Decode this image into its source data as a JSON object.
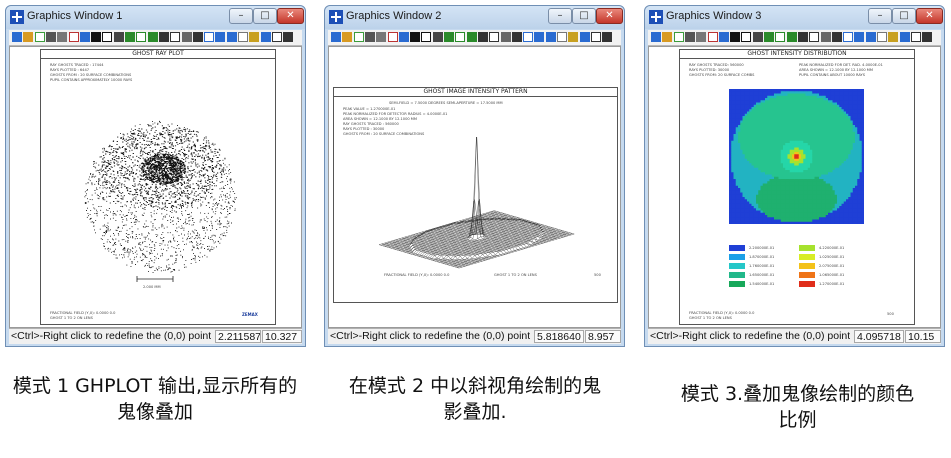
{
  "windows": [
    {
      "title": "Graphics Window 1",
      "plot_title": "GHOST RAY PLOT",
      "info_lines": [
        "RAY GHOSTS TRACED : 17444",
        "RAYS PLOTTED : 6447",
        "GHOSTS FROM : 20 SURFACE COMBINATIONS",
        "PUPIL CONTAINS APPROXIMATELY 10000 RAYS"
      ],
      "scale_label": "2.000 MM",
      "footer_lines": [
        "FRACTIONAL FIELD (Y,X): 0.0000 0.0",
        "GHOST 1 TO 2 ON LENS"
      ],
      "footer_right": "ZEMAX",
      "status": {
        "message": "<Ctrl>-Right click to redefine the (0,0) point",
        "x": "2.211587",
        "y": "10.327"
      },
      "caption": "模式 1 GHPLOT 输出,显示所有的鬼像叠加"
    },
    {
      "title": "Graphics Window 2",
      "plot_title": "GHOST IMAGE INTENSITY PATTERN",
      "info_lines": [
        "SEMI-FIELD = 7.5000 DEGREES  SEMI-APERTURE = 17.5000 MM",
        "PEAK VALUE = 1.270000E-01",
        "PEAK NORMALIZED FOR DETECTOR RADIUS = 4.0000E-01",
        "AREA SHOWN = 12.1000 BY 12.1000 MM",
        "RAY GHOSTS TRACED : 560000",
        "RAYS PLOTTED : 30000",
        "GHOSTS FROM : 20 SURFACE COMBINATIONS"
      ],
      "footer_lines": [
        "FRACTIONAL FIELD (Y,X): 0.0000 0.0",
        "GHOST 1 TO 2 ON LENS"
      ],
      "footer_right": "500",
      "status": {
        "message": "<Ctrl>-Right click to redefine the (0,0) point",
        "x": "5.818640",
        "y": "8.957"
      },
      "caption": "在模式 2 中以斜视角绘制的鬼影叠加."
    },
    {
      "title": "Graphics Window 3",
      "plot_title": "GHOST INTENSITY DISTRIBUTION",
      "info_lines": [
        "RAY GHOSTS TRACED: 560000",
        "RAYS PLOTTED: 30000",
        "GHOSTS FROM: 20 SURFACE COMBS",
        "PEAK NORMALIZED FOR DET. RAD. 4.0000E-01",
        "AREA SHOWN = 12.1000 BY 12.1000 MM",
        "PUPIL CONTAINS ABOUT 10000 RAYS"
      ],
      "legend": [
        {
          "value": "2.200000E-01",
          "color": "#1f3fd6"
        },
        {
          "value": "1.870000E-01",
          "color": "#1ba0e8"
        },
        {
          "value": "1.760000E-01",
          "color": "#25c7c8"
        },
        {
          "value": "1.650000E-01",
          "color": "#21b88a"
        },
        {
          "value": "1.540000E-01",
          "color": "#17a85a"
        },
        {
          "value": "4.220000E-01",
          "color": "#a6e22e"
        },
        {
          "value": "1.025000E-01",
          "color": "#d8ed25"
        },
        {
          "value": "2.075000E-01",
          "color": "#f3c21a"
        },
        {
          "value": "1.065000E-01",
          "color": "#ef7417"
        },
        {
          "value": "1.270000E-01",
          "color": "#e02d1a"
        }
      ],
      "footer_lines": [
        "FRACTIONAL FIELD (Y,X): 0.0000 0.0",
        "GHOST 1 TO 2 ON LENS"
      ],
      "footer_right": "500",
      "status": {
        "message": "<Ctrl>-Right click to redefine the (0,0) point",
        "x": "4.095718",
        "y": "10.15"
      },
      "caption": "模式 3.叠加鬼像绘制的颜色比例"
    }
  ],
  "toolbar_icons": [
    "save-icon",
    "open-icon",
    "zoom-icon",
    "print-icon",
    "copy-icon",
    "settings-icon",
    "update-icon",
    "window-icon",
    "black-box-icon",
    "lines-icon",
    "color-icon",
    "gray-icon",
    "color2-icon",
    "text-icon",
    "list-icon",
    "grid-icon",
    "menu-icon",
    "zoom-in-icon",
    "zoom-out-icon",
    "zoom-fit-icon",
    "pointer-icon",
    "help-icon",
    "export-icon",
    "close-panel-icon",
    "forward-icon"
  ],
  "colors": {
    "titlebar": "#c6daef",
    "close": "#c4362a",
    "zemax_logo": "#1b3d9c"
  }
}
